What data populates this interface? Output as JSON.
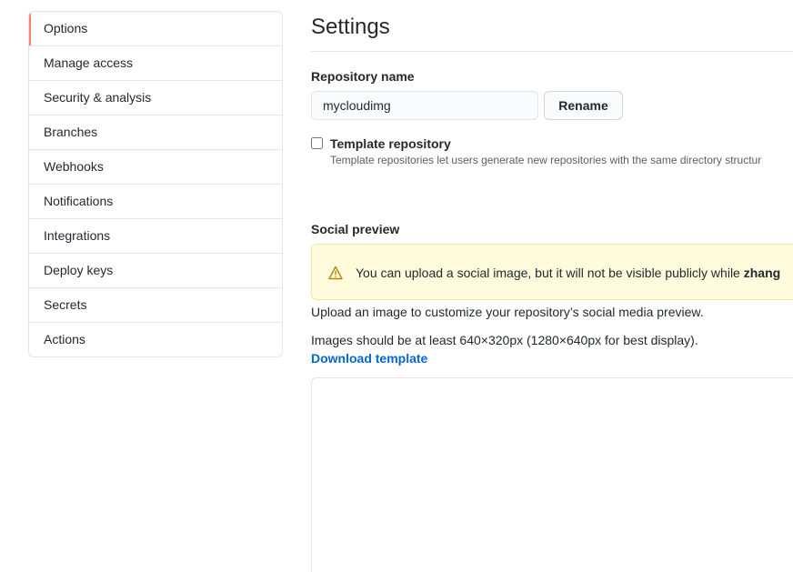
{
  "sidebar": {
    "items": [
      {
        "label": "Options",
        "selected": true
      },
      {
        "label": "Manage access"
      },
      {
        "label": "Security & analysis"
      },
      {
        "label": "Branches"
      },
      {
        "label": "Webhooks"
      },
      {
        "label": "Notifications"
      },
      {
        "label": "Integrations"
      },
      {
        "label": "Deploy keys"
      },
      {
        "label": "Secrets"
      },
      {
        "label": "Actions"
      }
    ],
    "accent_color": "#f9826c"
  },
  "main": {
    "title": "Settings",
    "repository_name": {
      "label": "Repository name",
      "value": "mycloudimg",
      "rename_label": "Rename"
    },
    "template": {
      "label": "Template repository",
      "checked": false,
      "note": "Template repositories let users generate new repositories with the same directory structur"
    },
    "social_preview": {
      "heading": "Social preview",
      "warning_icon": "alert-icon",
      "warning_text": "You can upload a social image, but it will not be visible publicly while ",
      "warning_emphasis": "zhang",
      "description": "Upload an image to customize your repository’s social media preview.",
      "size_hint": "Images should be at least 640×320px (1280×640px for best display).",
      "download_label": "Download template"
    }
  },
  "colors": {
    "link": "#0366d6",
    "warning_bg": "#fffbdd",
    "warning_icon": "#b08800",
    "border": "#e1e4e8"
  }
}
